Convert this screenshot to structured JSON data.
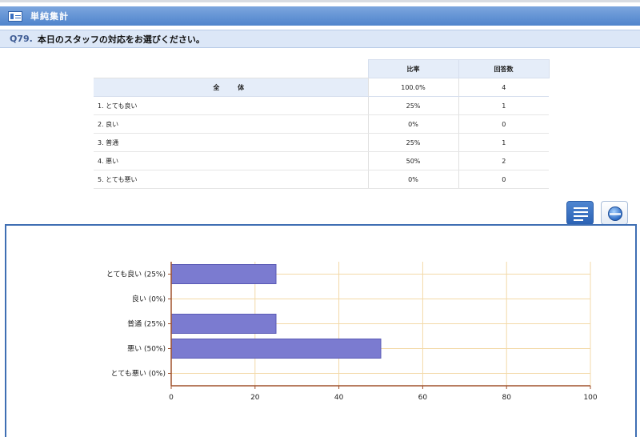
{
  "section": {
    "title": "単純集計",
    "icon": "summary-table-icon"
  },
  "question": {
    "number": "Q79.",
    "text": "本日のスタッフの対応をお選びください。"
  },
  "table": {
    "headers": {
      "rate": "比率",
      "count": "回答数"
    },
    "total": {
      "label": "全 体",
      "rate": "100.0%",
      "count": "4"
    },
    "rows": [
      {
        "label": "1. とても良い",
        "rate": "25%",
        "count": "1"
      },
      {
        "label": "2. 良い",
        "rate": "0%",
        "count": "0"
      },
      {
        "label": "3. 普通",
        "rate": "25%",
        "count": "1"
      },
      {
        "label": "4. 悪い",
        "rate": "50%",
        "count": "2"
      },
      {
        "label": "5. とても悪い",
        "rate": "0%",
        "count": "0"
      }
    ]
  },
  "view_buttons": {
    "bar": "bar-chart-view-icon",
    "pie": "pie-chart-view-icon"
  },
  "colors": {
    "bar": "#7b7bd0",
    "bar_edge": "#5a5ab5",
    "grid": "#f3d9a8",
    "axis": "#a0522d",
    "header": "#5a8fd6"
  },
  "chart_data": {
    "type": "bar",
    "orientation": "horizontal",
    "categories": [
      "とても良い (25%)",
      "良い (0%)",
      "普通 (25%)",
      "悪い (50%)",
      "とても悪い (0%)"
    ],
    "values": [
      25,
      0,
      25,
      50,
      0
    ],
    "xlim": [
      0,
      100
    ],
    "xticks": [
      0,
      20,
      40,
      60,
      80,
      100
    ],
    "grid": true
  }
}
